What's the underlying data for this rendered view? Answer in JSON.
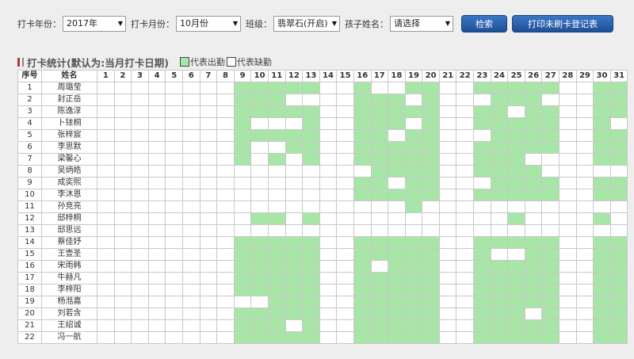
{
  "toolbar": {
    "year_label": "打卡年份：",
    "year_value": "2017年",
    "month_label": "打卡月份：",
    "month_value": "10月份",
    "class_label": "班级：",
    "class_value": "翡翠石(开启)",
    "child_label": "孩子姓名：",
    "child_value": "请选择",
    "search_label": "检索",
    "print_label": "打印未刷卡登记表"
  },
  "heading": {
    "title": "打卡统计(默认为:当月打卡日期)",
    "legend_present": "代表出勤",
    "legend_absent": "代表缺勤"
  },
  "colors": {
    "present": "#a8e6a8",
    "absent": "#ffffff",
    "button": "#2a5fae"
  },
  "table": {
    "col_index": "序号",
    "col_name": "姓名",
    "days": [
      "1",
      "2",
      "3",
      "4",
      "5",
      "6",
      "7",
      "8",
      "9",
      "10",
      "11",
      "12",
      "13",
      "14",
      "15",
      "16",
      "17",
      "18",
      "19",
      "20",
      "21",
      "22",
      "23",
      "24",
      "25",
      "26",
      "27",
      "28",
      "29",
      "30",
      "31"
    ],
    "rows": [
      {
        "no": "1",
        "name": "周璐莹",
        "present": [
          9,
          10,
          11,
          12,
          13,
          16,
          19,
          20,
          23,
          24,
          25,
          26,
          27,
          30,
          31
        ]
      },
      {
        "no": "2",
        "name": "封正岳",
        "present": [
          9,
          10,
          11,
          16,
          17,
          18,
          20,
          24,
          25,
          26,
          30,
          31
        ]
      },
      {
        "no": "3",
        "name": "陈逸淳",
        "present": [
          9,
          10,
          11,
          12,
          13,
          16,
          17,
          18,
          19,
          20,
          23,
          24,
          26,
          27,
          30,
          31
        ]
      },
      {
        "no": "4",
        "name": "卜铱桐",
        "present": [
          9,
          13,
          16,
          17,
          18,
          20,
          23,
          24,
          25,
          26,
          27,
          30
        ]
      },
      {
        "no": "5",
        "name": "张梓宸",
        "present": [
          9,
          10,
          11,
          12,
          13,
          16,
          17,
          19,
          20,
          24,
          25,
          26,
          27,
          30,
          31
        ]
      },
      {
        "no": "6",
        "name": "李思默",
        "present": [
          9,
          12,
          13,
          16,
          17,
          18,
          19,
          20,
          23,
          24,
          25,
          26,
          27,
          30,
          31
        ]
      },
      {
        "no": "7",
        "name": "梁馨心",
        "present": [
          9,
          11,
          13,
          16,
          17,
          18,
          19,
          20,
          23,
          24,
          25,
          30,
          31
        ]
      },
      {
        "no": "8",
        "name": "吴炳皓",
        "present": [
          17,
          18,
          19,
          20,
          23,
          24,
          25,
          26
        ]
      },
      {
        "no": "9",
        "name": "成奕熙",
        "present": [
          16,
          17,
          19,
          20,
          24,
          25,
          26,
          27,
          30,
          31
        ]
      },
      {
        "no": "10",
        "name": "李沐恩",
        "present": [
          16,
          17,
          18,
          19,
          20,
          23,
          24,
          25,
          26,
          27,
          30,
          31
        ]
      },
      {
        "no": "11",
        "name": "孙竞亮",
        "present": [
          19
        ]
      },
      {
        "no": "12",
        "name": "邸梓桐",
        "present": [
          10,
          11,
          13,
          25,
          30
        ]
      },
      {
        "no": "13",
        "name": "邸思远",
        "present": []
      },
      {
        "no": "14",
        "name": "蔡佳妤",
        "present": [
          9,
          10,
          11,
          12,
          13,
          16,
          17,
          18,
          19,
          20,
          23,
          24,
          25,
          26,
          27,
          30,
          31
        ]
      },
      {
        "no": "15",
        "name": "王壹圣",
        "present": [
          9,
          10,
          11,
          12,
          13,
          16,
          17,
          18,
          19,
          20,
          23,
          26,
          27,
          30,
          31
        ]
      },
      {
        "no": "16",
        "name": "宋雨韩",
        "present": [
          9,
          10,
          11,
          12,
          13,
          16,
          18,
          19,
          20,
          23,
          24,
          25,
          26,
          27,
          30,
          31
        ]
      },
      {
        "no": "17",
        "name": "牛赫凡",
        "present": [
          9,
          10,
          11,
          12,
          13,
          16,
          17,
          18,
          19,
          20,
          23,
          24,
          25,
          26,
          27,
          30,
          31
        ]
      },
      {
        "no": "18",
        "name": "李梓阳",
        "present": [
          9,
          10,
          11,
          12,
          13,
          16,
          17,
          18,
          19,
          20,
          23,
          24,
          25,
          26,
          27,
          30,
          31
        ]
      },
      {
        "no": "19",
        "name": "杨湉嘉",
        "present": [
          11,
          12,
          13,
          16,
          17,
          18,
          19,
          20,
          23,
          24,
          25,
          26,
          27,
          30,
          31
        ]
      },
      {
        "no": "20",
        "name": "刘若含",
        "present": [
          9,
          10,
          11,
          12,
          13,
          16,
          17,
          18,
          19,
          20,
          23,
          24,
          25,
          27,
          30,
          31
        ]
      },
      {
        "no": "21",
        "name": "王绍诚",
        "present": [
          9,
          10,
          11,
          13,
          16,
          17,
          18,
          19,
          20,
          23,
          24,
          25,
          26,
          27,
          30,
          31
        ]
      },
      {
        "no": "22",
        "name": "冯一航",
        "present": [
          9,
          10,
          11,
          12,
          13,
          16,
          17,
          18,
          19,
          20,
          23,
          24,
          25,
          26,
          27,
          30,
          31
        ]
      }
    ]
  }
}
